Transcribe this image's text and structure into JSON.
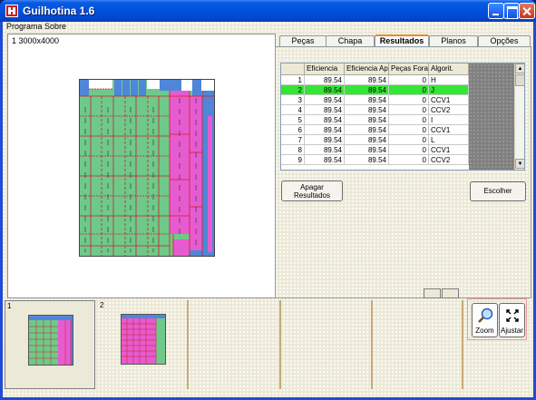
{
  "window": {
    "title": "Guilhotina 1.6"
  },
  "menu": [
    "Programa",
    "Sobre"
  ],
  "preview": {
    "label": "1 3000x4000"
  },
  "tabs": [
    "Peças",
    "Chapa",
    "Resultados",
    "Planos",
    "Opções"
  ],
  "active_tab": "Resultados",
  "results_table": {
    "columns": [
      "",
      "Eficiencia",
      "Eficiencia Ap",
      "Peças Fora",
      "Algorit."
    ],
    "selected_row": 2,
    "rows": [
      [
        "1",
        "89.54",
        "89.54",
        "0",
        "H"
      ],
      [
        "2",
        "89.54",
        "89.54",
        "0",
        "J"
      ],
      [
        "3",
        "89.54",
        "89.54",
        "0",
        "CCV1"
      ],
      [
        "4",
        "89.54",
        "89.54",
        "0",
        "CCV2"
      ],
      [
        "5",
        "89.54",
        "89.54",
        "0",
        "I"
      ],
      [
        "6",
        "89.54",
        "89.54",
        "0",
        "CCV1"
      ],
      [
        "7",
        "89.54",
        "89.54",
        "0",
        "L"
      ],
      [
        "8",
        "89.54",
        "89.54",
        "0",
        "CCV1"
      ],
      [
        "9",
        "89.54",
        "89.54",
        "0",
        "CCV2"
      ]
    ]
  },
  "buttons": {
    "apagar_line1": "Apagar",
    "apagar_line2": "Resultados",
    "escolher": "Escolher",
    "zoom": "Zoom",
    "ajustar": "Ajustar"
  },
  "thumbnails": [
    {
      "number": "1"
    },
    {
      "number": "2"
    }
  ],
  "colors": {
    "piece_green": "#6ec98a",
    "piece_pink": "#e75bd0",
    "piece_blue": "#4f86d8",
    "cut_line": "#cc2020",
    "selected_row": "#33e633"
  }
}
